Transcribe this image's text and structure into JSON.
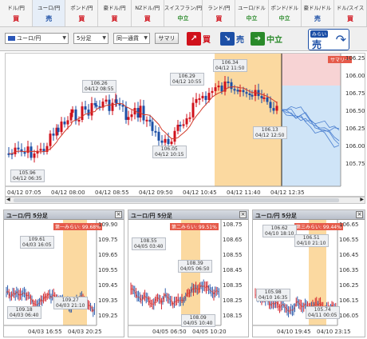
{
  "tabs": [
    {
      "pair": "ドル/円",
      "signal": "買",
      "type": "buy"
    },
    {
      "pair": "ユーロ/円",
      "signal": "売",
      "type": "sell",
      "active": true
    },
    {
      "pair": "ポンド/円",
      "signal": "買",
      "type": "buy"
    },
    {
      "pair": "豪ドル/円",
      "signal": "買",
      "type": "buy"
    },
    {
      "pair": "NZドル/円",
      "signal": "買",
      "type": "buy"
    },
    {
      "pair": "スイスフラン/円",
      "signal": "中立",
      "type": "neutral"
    },
    {
      "pair": "ランド/円",
      "signal": "買",
      "type": "buy"
    },
    {
      "pair": "ユーロ/ドル",
      "signal": "中立",
      "type": "neutral"
    },
    {
      "pair": "ポンド/ドル",
      "signal": "中立",
      "type": "neutral"
    },
    {
      "pair": "豪ドル/ドル",
      "signal": "売",
      "type": "sell"
    },
    {
      "pair": "ドル/スイス",
      "signal": "買",
      "type": "buy"
    }
  ],
  "toolbar": {
    "pair_select": "ユーロ/円",
    "interval_select": "5分足",
    "sync_select": "同一通貨",
    "summary_button": "サマリ",
    "buy_label": "買",
    "sell_label": "売",
    "neutral_label": "中立",
    "mirai_caption": "みらい",
    "mirai_signal": "売"
  },
  "main_chart": {
    "summary_badge": "サマリー",
    "y_ticks": [
      "106.25",
      "106.00",
      "106.75",
      "106.50",
      "106.25",
      "106.00",
      "105.75"
    ],
    "x_ticks": [
      "04/12 07:05",
      "04/12 08:00",
      "04/12 08:55",
      "04/12 09:50",
      "04/12 10:45",
      "04/12 11:40",
      "04/12 12:35"
    ],
    "callouts": [
      {
        "price": "105.96",
        "time": "04/12 06:35"
      },
      {
        "price": "106.26",
        "time": "04/12 08:55"
      },
      {
        "price": "106.05",
        "time": "04/12 10:15"
      },
      {
        "price": "106.29",
        "time": "04/12 10:55"
      },
      {
        "price": "106.34",
        "time": "04/12 11:50"
      },
      {
        "price": "106.13",
        "time": "04/12 12:50"
      }
    ]
  },
  "mini_panels": [
    {
      "title": "ユーロ/円 5分足",
      "badge": "第一みらい: 99.68%",
      "y_ticks": [
        "109.90",
        "109.75",
        "109.65",
        "109.55",
        "109.45",
        "109.35",
        "109.25"
      ],
      "x_ticks": [
        "04/03 16:55",
        "04/03 20:25"
      ],
      "callouts": [
        {
          "price": "109.61",
          "time": "04/03 16:05"
        },
        {
          "price": "109.18",
          "time": "04/03 06:40"
        },
        {
          "price": "109.27",
          "time": "04/03 21:10"
        }
      ]
    },
    {
      "title": "ユーロ/円 5分足",
      "badge": "第二みらい: 99.51%",
      "y_ticks": [
        "108.75",
        "108.65",
        "108.55",
        "108.45",
        "108.35",
        "108.25",
        "108.15"
      ],
      "x_ticks": [
        "04/05 06:50",
        "04/05 10:20"
      ],
      "callouts": [
        {
          "price": "108.55",
          "time": "04/05 03:40"
        },
        {
          "price": "108.39",
          "time": "04/05 06:50"
        },
        {
          "price": "108.09",
          "time": "04/05 10:40"
        }
      ]
    },
    {
      "title": "ユーロ/円 5分足",
      "badge": "第三みらい: 99.44%",
      "y_ticks": [
        "106.65",
        "106.55",
        "106.45",
        "106.35",
        "106.25",
        "106.15",
        "106.05"
      ],
      "x_ticks": [
        "04/10 19:45",
        "04/10 23:15"
      ],
      "callouts": [
        {
          "price": "106.62",
          "time": "04/10 18:10"
        },
        {
          "price": "106.51",
          "time": "04/10 21:10"
        },
        {
          "price": "105.98",
          "time": "04/10 16:35"
        },
        {
          "price": "105.74",
          "time": "04/11 00:05"
        }
      ]
    }
  ],
  "colors": {
    "up": "#d0111b",
    "down": "#1c4fa6",
    "highlight": "#fbd9a0",
    "future": "#cfe4f7",
    "ma": "#d23a2a"
  }
}
